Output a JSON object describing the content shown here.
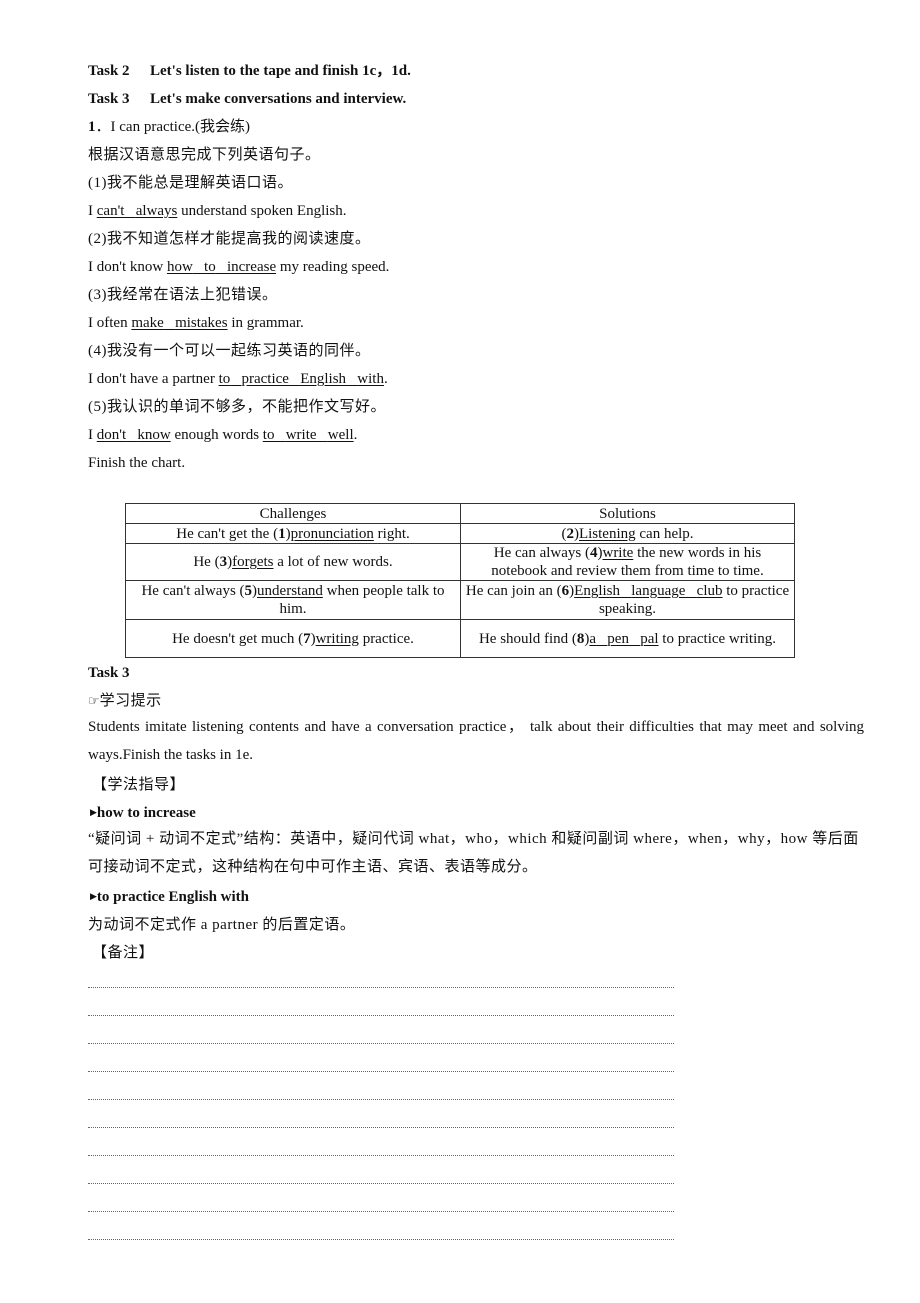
{
  "tasks": {
    "task2": {
      "label": "Task 2",
      "text": "Let's listen to the tape and finish 1c，1d."
    },
    "task3": {
      "label": "Task 3",
      "text": "Let's make conversations and interview."
    }
  },
  "practice": {
    "number": "1",
    "title": "I can practice.(我会练)",
    "instruction": "根据汉语意思完成下列英语句子。",
    "items": [
      {
        "cn": "(1)我不能总是理解英语口语。",
        "pre": "I ",
        "answers": [
          "can't",
          "always"
        ],
        "post": " understand spoken English."
      },
      {
        "cn": "(2)我不知道怎样才能提高我的阅读速度。",
        "pre": "I don't know ",
        "answers": [
          "how",
          "to",
          "increase"
        ],
        "post": " my reading speed."
      },
      {
        "cn": "(3)我经常在语法上犯错误。",
        "pre": "I often ",
        "answers": [
          "make",
          "mistakes"
        ],
        "post": " in grammar."
      },
      {
        "cn": "(4)我没有一个可以一起练习英语的同伴。",
        "pre": "I don't have a partner ",
        "answers": [
          "to",
          "practice",
          "English",
          "with"
        ],
        "post": "."
      },
      {
        "cn": "(5)我认识的单词不够多，不能把作文写好。",
        "pre": "I ",
        "answers": [
          "don't",
          "know"
        ],
        "mid": " enough words ",
        "answers2": [
          "to",
          "write",
          "well"
        ],
        "post": "."
      }
    ],
    "finish_chart": "Finish the chart."
  },
  "table": {
    "headers": [
      "Challenges",
      "Solutions"
    ],
    "rows": [
      {
        "c_pre": "He can't get the (",
        "c_num": "1",
        "c_close": ")",
        "c_ans": "pronunciation",
        "c_post": " right.",
        "s_pre": "(",
        "s_num": "2",
        "s_close": ")",
        "s_ans": "Listening",
        "s_post": " can help."
      },
      {
        "c_pre": "He (",
        "c_num": "3",
        "c_close": ")",
        "c_ans": "forgets",
        "c_post": " a lot of new words.",
        "s_pre": "He can always (",
        "s_num": "4",
        "s_close": ")",
        "s_ans": "write",
        "s_post": " the new words in his notebook and review them from time to time."
      },
      {
        "c_pre": "He can't always (",
        "c_num": "5",
        "c_close": ")",
        "c_ans": "understand",
        "c_post": " when people talk to him.",
        "s_pre": "He can join an (",
        "s_num": "6",
        "s_close": ")",
        "s_ans": [
          "English",
          "language",
          "club"
        ],
        "s_post": " to practice speaking."
      },
      {
        "c_pre": "He doesn't get much (",
        "c_num": "7",
        "c_close": ")",
        "c_ans": "writing",
        "c_post": " practice.",
        "s_pre": "He should find (",
        "s_num": "8",
        "s_close": ")",
        "s_ans": [
          "a",
          "pen",
          "pal"
        ],
        "s_post": " to practice writing."
      }
    ]
  },
  "task3_section": {
    "label": "Task 3",
    "hint_icon": "pointing-hand-icon",
    "hint_title": "学习提示",
    "hint_text": "Students imitate listening contents and have a conversation practice， talk about their difficulties that may meet and solving ways.Finish the tasks in 1e.",
    "guide_title": "【学法指导】",
    "notes": [
      {
        "icon": "triangle-bullet-icon",
        "heading": "how to increase",
        "text": "“疑问词 + 动词不定式”结构：英语中，疑问代词 what，who，which 和疑问副词 where，when，why，how 等后面可接动词不定式，这种结构在句中可作主语、宾语、表语等成分。"
      },
      {
        "icon": "triangle-bullet-icon",
        "heading": "to practice English with",
        "text": "为动词不定式作 a partner 的后置定语。"
      }
    ],
    "remarks_title": "【备注】",
    "remark_lines": 10
  }
}
